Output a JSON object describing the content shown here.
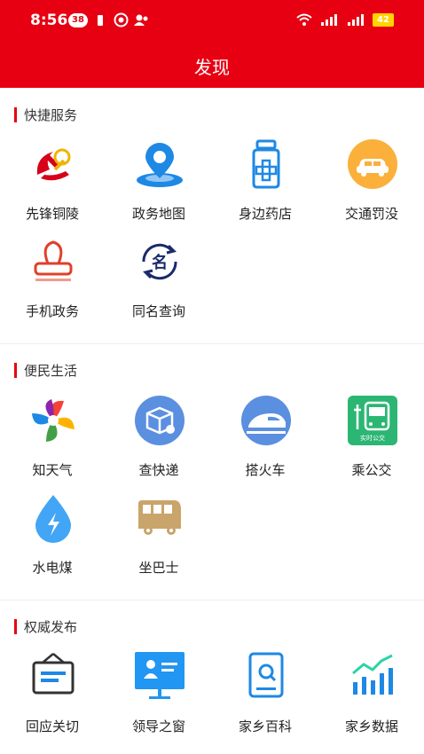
{
  "status_bar": {
    "time": "8:56",
    "badge": "38",
    "battery": "42"
  },
  "header": {
    "title": "发现"
  },
  "colors": {
    "brand": "#e60012",
    "accent_blue": "#1e88e5"
  },
  "sections": [
    {
      "title": "快捷服务",
      "items": [
        {
          "label": "先锋铜陵",
          "icon": "party-emblem-icon"
        },
        {
          "label": "政务地图",
          "icon": "map-pin-icon"
        },
        {
          "label": "身边药店",
          "icon": "pharmacy-bottle-icon"
        },
        {
          "label": "交通罚没",
          "icon": "car-icon"
        },
        {
          "label": "手机政务",
          "icon": "stamp-icon"
        },
        {
          "label": "同名查询",
          "icon": "name-search-icon"
        }
      ]
    },
    {
      "title": "便民生活",
      "items": [
        {
          "label": "知天气",
          "icon": "weather-pinwheel-icon"
        },
        {
          "label": "查快递",
          "icon": "parcel-icon"
        },
        {
          "label": "搭火车",
          "icon": "train-icon"
        },
        {
          "label": "乘公交",
          "icon": "bus-icon",
          "icon_text": "实时公交"
        },
        {
          "label": "水电煤",
          "icon": "utility-drop-icon"
        },
        {
          "label": "坐巴士",
          "icon": "coach-bus-icon"
        }
      ]
    },
    {
      "title": "权威发布",
      "items": [
        {
          "label": "回应关切",
          "icon": "notice-board-icon"
        },
        {
          "label": "领导之窗",
          "icon": "leader-window-icon"
        },
        {
          "label": "家乡百科",
          "icon": "encyclopedia-icon"
        },
        {
          "label": "家乡数据",
          "icon": "data-chart-icon"
        }
      ]
    }
  ]
}
